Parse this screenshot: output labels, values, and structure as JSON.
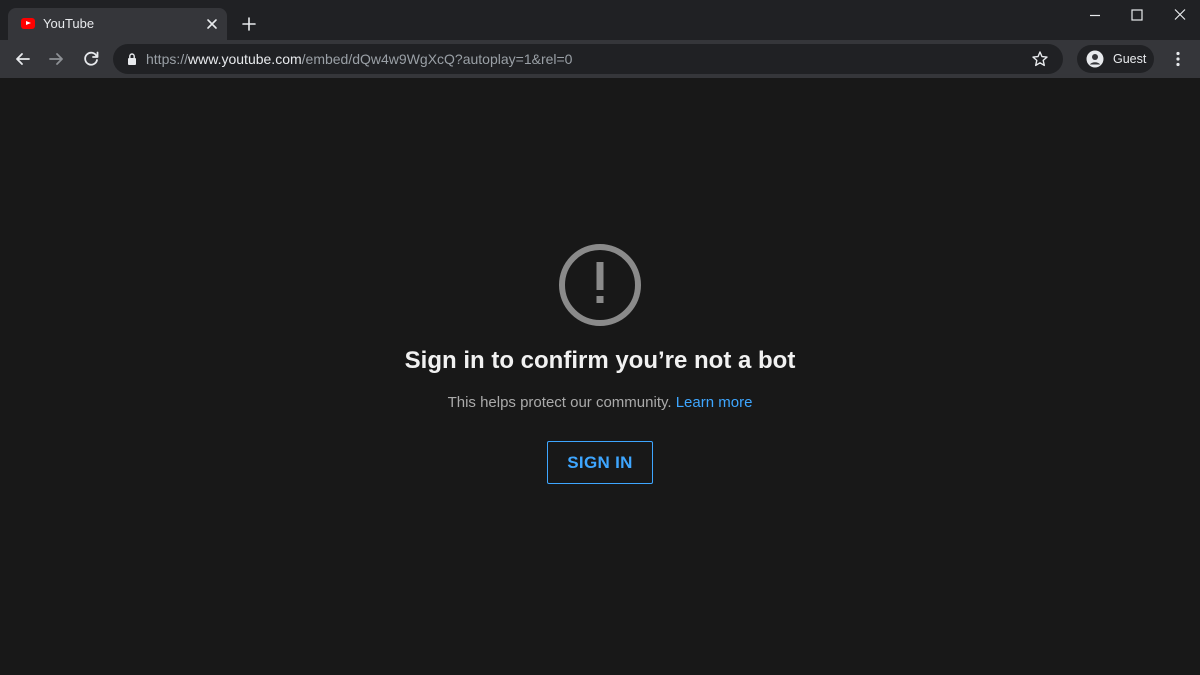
{
  "browser": {
    "tab": {
      "title": "YouTube",
      "favicon": "youtube-icon"
    },
    "new_tab_icon": "plus-icon",
    "window_controls": [
      "minimize-icon",
      "maximize-icon",
      "close-icon"
    ],
    "address": {
      "scheme": "https://",
      "host": "www.youtube.com",
      "path": "/embed/dQw4w9WgXcQ?autoplay=1&rel=0"
    },
    "profile": {
      "name": "Guest"
    }
  },
  "page": {
    "icon": "alert-circle-icon",
    "headline": "Sign in to confirm you’re not a bot",
    "subline": "This helps protect our community.",
    "learn_more": "Learn more",
    "signin_label": "SIGN IN"
  },
  "colors": {
    "accent": "#3ea6ff",
    "background": "#181818",
    "brand_red": "#ff0000"
  }
}
